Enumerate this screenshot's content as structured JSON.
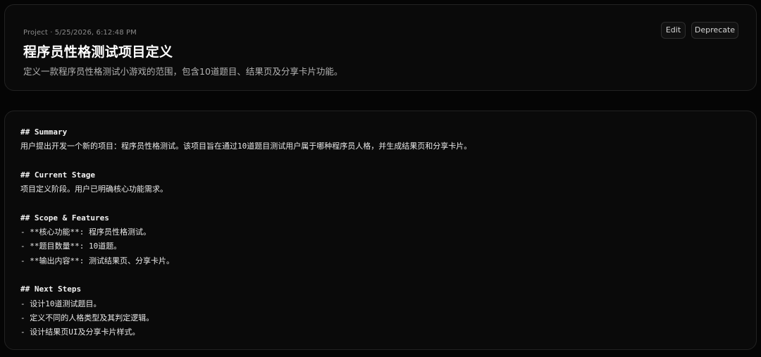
{
  "header": {
    "meta": "Project · 5/25/2026, 6:12:48 PM",
    "title": "程序员性格测试项目定义",
    "description": "定义一款程序员性格测试小游戏的范围，包含10道题目、结果页及分享卡片功能。",
    "edit_label": "Edit",
    "deprecate_label": "Deprecate"
  },
  "content": {
    "lines": [
      "## Summary",
      "用户提出开发一个新的项目：程序员性格测试。该项目旨在通过10道题目测试用户属于哪种程序员人格，并生成结果页和分享卡片。",
      "",
      "## Current Stage",
      "项目定义阶段。用户已明确核心功能需求。",
      "",
      "## Scope & Features",
      "- **核心功能**: 程序员性格测试。",
      "- **题目数量**: 10道题。",
      "- **输出内容**: 测试结果页、分享卡片。",
      "",
      "## Next Steps",
      "- 设计10道测试题目。",
      "- 定义不同的人格类型及其判定逻辑。",
      "- 设计结果页UI及分享卡片样式。"
    ]
  }
}
